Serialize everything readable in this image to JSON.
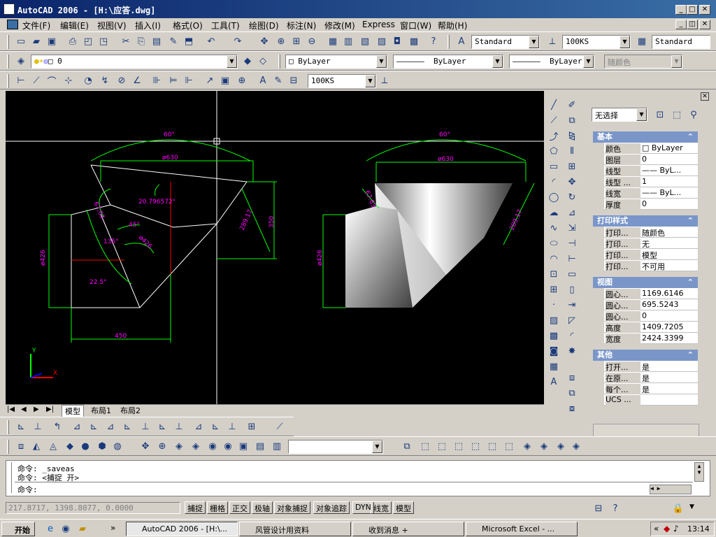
{
  "window": {
    "title": "AutoCAD 2006 - [H:\\应答.dwg]"
  },
  "menu": [
    "文件(F)",
    "编辑(E)",
    "视图(V)",
    "插入(I)",
    "格式(O)",
    "工具(T)",
    "绘图(D)",
    "标注(N)",
    "修改(M)",
    "Express",
    "窗口(W)",
    "帮助(H)"
  ],
  "toolbar1": {
    "text_style": "Standard",
    "dim_style": "100KS",
    "table_style": "Standard"
  },
  "layers": {
    "current_layer": "0",
    "color": "ByLayer",
    "linetype": "ByLayer",
    "lineweight": "ByLayer",
    "plotstyle": "随颜色"
  },
  "toolbar3": {
    "dim_style": "100KS"
  },
  "tabs": {
    "model": "模型",
    "layout1": "布局1",
    "layout2": "布局2"
  },
  "drawing": {
    "left": {
      "angle_top": "60°",
      "dia_top": "ø630",
      "dim_side": "289.17",
      "height": "350",
      "angle1": "20.796572°",
      "angle2": "45°",
      "dia_mid": "ø426",
      "angle3": "135°",
      "angle4": "22.5°",
      "dia_left": "ø426",
      "width": "450",
      "small": "67.63"
    },
    "right": {
      "angle_top": "60°",
      "dia_top": "ø630",
      "dim_side": "289.17",
      "dia_left": "ø426",
      "small": "67.63"
    },
    "colors": {
      "dim": "#00ff00",
      "text": "#ff00ff",
      "line": "#ffffff",
      "red": "#ff0000"
    }
  },
  "properties": {
    "selection": "无选择",
    "sections": {
      "basic": "基本",
      "plot": "打印样式",
      "view": "视图",
      "misc": "其他"
    },
    "basic": [
      [
        "颜色",
        "□ ByLayer"
      ],
      [
        "图层",
        "0"
      ],
      [
        "线型",
        "—— ByL..."
      ],
      [
        "线型 ...",
        "1"
      ],
      [
        "线宽",
        "—— ByL..."
      ],
      [
        "厚度",
        "0"
      ]
    ],
    "plot": [
      [
        "打印...",
        "随颜色"
      ],
      [
        "打印...",
        "无"
      ],
      [
        "打印...",
        "模型"
      ],
      [
        "打印...",
        "不可用"
      ]
    ],
    "view": [
      [
        "圆心...",
        "1169.6146"
      ],
      [
        "圆心...",
        "695.5243"
      ],
      [
        "圆心...",
        "0"
      ],
      [
        "高度",
        "1409.7205"
      ],
      [
        "宽度",
        "2424.3399"
      ]
    ],
    "misc": [
      [
        "打开...",
        "是"
      ],
      [
        "在原...",
        "是"
      ],
      [
        "每个...",
        "是"
      ],
      [
        "UCS ...",
        ""
      ]
    ]
  },
  "command": {
    "line1": "命令: _saveas",
    "line2": "命令: <捕捉 开>",
    "prompt": "命令:"
  },
  "status": {
    "coords": "217.8717, 1398.8077, 0.0000",
    "buttons": [
      "捕捉",
      "栅格",
      "正交",
      "极轴",
      "对象捕捉",
      "对象追踪",
      "DYN",
      "线宽",
      "模型"
    ]
  },
  "taskbar": {
    "start": "开始",
    "tasks": [
      "AutoCAD 2006 - [H:\\...",
      "风管设计用资料",
      "收到消息 +",
      "Microsoft Excel - ..."
    ],
    "clock": "13:14"
  }
}
